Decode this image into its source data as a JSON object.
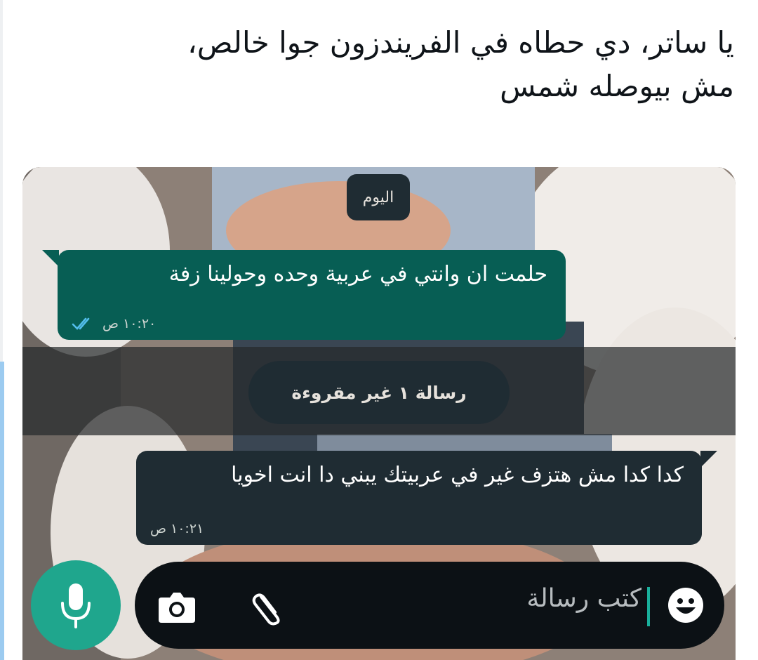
{
  "post": {
    "text": "يا ساتر، دي حطاه في الفريندزون جوا خالص،\nمش بيوصله شمس"
  },
  "chat": {
    "date_chip": "اليوم",
    "messages": [
      {
        "direction": "outgoing",
        "text": "حلمت ان وانتي في عربية وحده وحولينا زفة",
        "time": "١٠:٢٠ ص",
        "status": "read-double-check"
      },
      {
        "direction": "incoming",
        "text": "كدا كدا مش هتزف غير في عربيتك يبني دا انت اخويا",
        "time": "١٠:٢١ ص"
      }
    ],
    "unread_banner": "رسالة ١ غير مقروءة",
    "input": {
      "placeholder": "كتب رسالة"
    },
    "icons": [
      "emoji-icon",
      "attach-paperclip-icon",
      "camera-icon",
      "microphone-icon",
      "double-check-icon"
    ],
    "colors": {
      "outgoing_bubble": "#075e54",
      "incoming_bubble": "#1f2c33",
      "mic_button": "#1fa68d",
      "ticks": "#53bdeb"
    }
  }
}
